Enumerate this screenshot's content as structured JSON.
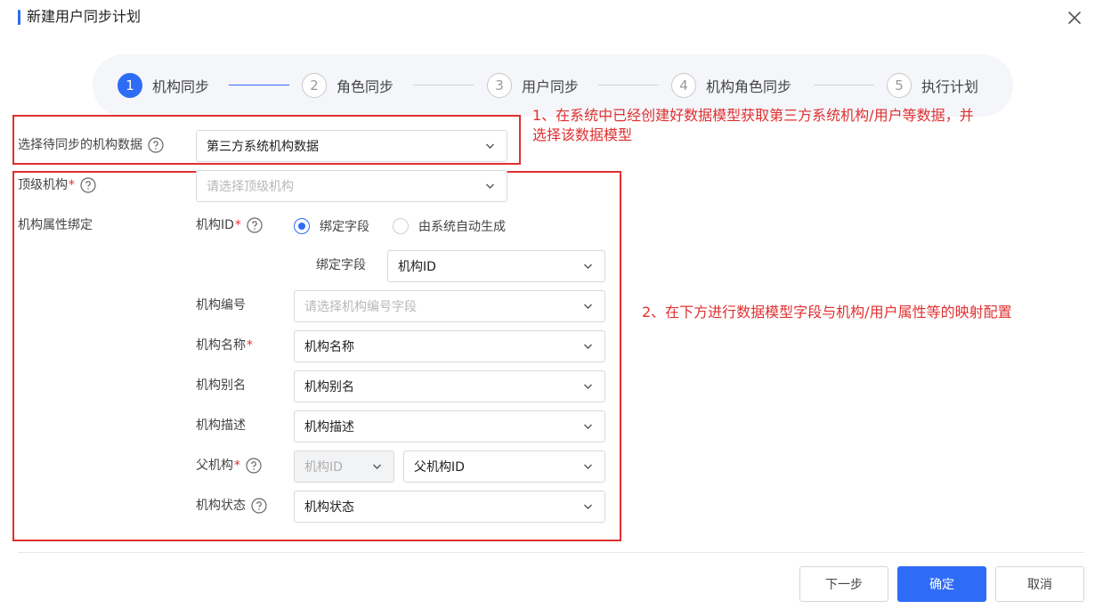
{
  "dialog": {
    "title": "新建用户同步计划",
    "accent_color": "#2f6cf6"
  },
  "steps": [
    {
      "number": "1",
      "label": "机构同步",
      "active": true
    },
    {
      "number": "2",
      "label": "角色同步",
      "active": false
    },
    {
      "number": "3",
      "label": "用户同步",
      "active": false
    },
    {
      "number": "4",
      "label": "机构角色同步",
      "active": false
    },
    {
      "number": "5",
      "label": "执行计划",
      "active": false
    }
  ],
  "annotations": {
    "note1_line1": "1、在系统中已经创建好数据模型获取第三方系统机构/用户等数据，并",
    "note1_line2": "选择该数据模型",
    "note2": "2、在下方进行数据模型字段与机构/用户属性等的映射配置",
    "color": "#e03030"
  },
  "form": {
    "source": {
      "label": "选择待同步的机构数据",
      "value": "第三方系统机构数据"
    },
    "top_org": {
      "label": "顶级机构",
      "required_mark": "*",
      "placeholder": "请选择顶级机构"
    },
    "attr_binding_label": "机构属性绑定",
    "org_id": {
      "label": "机构ID",
      "required_mark": "*",
      "options": [
        {
          "label": "绑定字段",
          "checked": true
        },
        {
          "label": "由系统自动生成",
          "checked": false
        }
      ],
      "bind_field_label": "绑定字段",
      "bind_field_value": "机构ID"
    },
    "org_code": {
      "label": "机构编号",
      "placeholder": "请选择机构编号字段"
    },
    "org_name": {
      "label": "机构名称",
      "required_mark": "*",
      "value": "机构名称"
    },
    "org_alias": {
      "label": "机构别名",
      "value": "机构别名"
    },
    "org_desc": {
      "label": "机构描述",
      "value": "机构描述"
    },
    "parent_org": {
      "label": "父机构",
      "required_mark": "*",
      "key_value": "机构ID",
      "value": "父机构ID"
    },
    "org_status": {
      "label": "机构状态",
      "value": "机构状态"
    }
  },
  "footer": {
    "next_label": "下一步",
    "confirm_label": "确定",
    "cancel_label": "取消"
  },
  "icons": {
    "close": "close-icon",
    "help": "question-circle-icon",
    "dropdown": "chevron-down-icon"
  }
}
